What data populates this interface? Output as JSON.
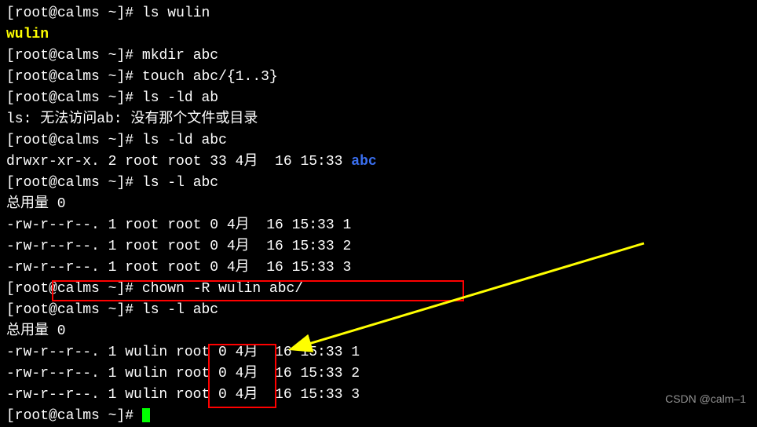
{
  "prompt": {
    "open": "[",
    "user": "root",
    "at": "@",
    "host": "calms",
    "sep": " ",
    "tilde": "~",
    "close": "]# "
  },
  "lines": {
    "l1_cmd": "ls wulin",
    "l2_out": "wulin",
    "l3_cmd": "mkdir abc",
    "l4_cmd": "touch abc/{1..3}",
    "l5_cmd": "ls -ld ab",
    "l6_out": "ls: 无法访问ab: 没有那个文件或目录",
    "l7_cmd": "ls -ld abc",
    "l8_pre": "drwxr-xr-x. 2 root root 33 4月  16 15:33 ",
    "l8_abc": "abc",
    "l9_cmd": "ls -l abc",
    "l10_out": "总用量 0",
    "l11_out": "-rw-r--r--. 1 root root 0 4月  16 15:33 1",
    "l12_out": "-rw-r--r--. 1 root root 0 4月  16 15:33 2",
    "l13_out": "-rw-r--r--. 1 root root 0 4月  16 15:33 3",
    "l14_cmd": "chown -R wulin abc/",
    "l15_cmd": "ls -l abc",
    "l16_out": "总用量 0",
    "l17_out": "-rw-r--r--. 1 wulin root 0 4月  16 15:33 1",
    "l18_out": "-rw-r--r--. 1 wulin root 0 4月  16 15:33 2",
    "l19_out": "-rw-r--r--. 1 wulin root 0 4月  16 15:33 3",
    "l20_partial": "["
  },
  "watermark": "CSDN @calm–1",
  "chart_data": null
}
